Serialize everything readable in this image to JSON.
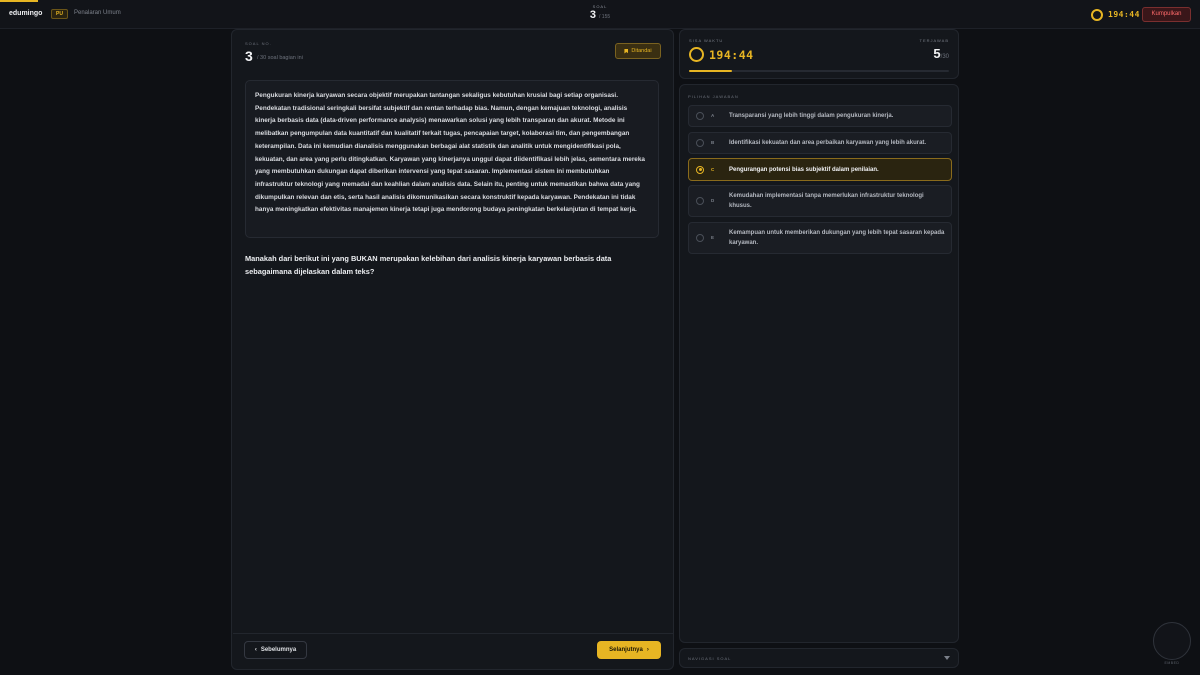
{
  "topbar": {
    "brand": "edumingo",
    "badge": "PU",
    "subject": "Penalaran Umum",
    "soal_label": "SOAL",
    "soal_current": "3",
    "soal_total": "/ 155",
    "timer": "194:44",
    "submit_label": "Kumpulkan"
  },
  "question_panel": {
    "soal_label": "SOAL NO.",
    "number": "3",
    "section_info": "/ 30 soal bagian ini",
    "mark_label": "Ditandai",
    "passage": "Pengukuran kinerja karyawan secara objektif merupakan tantangan sekaligus kebutuhan krusial bagi setiap organisasi. Pendekatan tradisional seringkali bersifat subjektif dan rentan terhadap bias. Namun, dengan kemajuan teknologi, analisis kinerja berbasis data (data-driven performance analysis) menawarkan solusi yang lebih transparan dan akurat. Metode ini melibatkan pengumpulan data kuantitatif dan kualitatif terkait tugas, pencapaian target, kolaborasi tim, dan pengembangan keterampilan. Data ini kemudian dianalisis menggunakan berbagai alat statistik dan analitik untuk mengidentifikasi pola, kekuatan, dan area yang perlu ditingkatkan. Karyawan yang kinerjanya unggul dapat diidentifikasi lebih jelas, sementara mereka yang membutuhkan dukungan dapat diberikan intervensi yang tepat sasaran. Implementasi sistem ini membutuhkan infrastruktur teknologi yang memadai dan keahlian dalam analisis data. Selain itu, penting untuk memastikan bahwa data yang dikumpulkan relevan dan etis, serta hasil analisis dikomunikasikan secara konstruktif kepada karyawan. Pendekatan ini tidak hanya meningkatkan efektivitas manajemen kinerja tetapi juga mendorong budaya peningkatan berkelanjutan di tempat kerja.",
    "question": "Manakah dari berikut ini yang BUKAN merupakan kelebihan dari analisis kinerja karyawan berbasis data sebagaimana dijelaskan dalam teks?",
    "prev_label": "Sebelumnya",
    "next_label": "Selanjutnya"
  },
  "status": {
    "time_label": "SISA WAKTU",
    "time_value": "194:44",
    "answered_label": "TERJAWAB",
    "answered_value": "5",
    "answered_total": "/30",
    "progress_fraction": 0.167
  },
  "options": {
    "label": "PILIHAN JAWABAN",
    "selected": "C",
    "items": [
      {
        "letter": "A",
        "text": "Transparansi yang lebih tinggi dalam pengukuran kinerja."
      },
      {
        "letter": "B",
        "text": "Identifikasi kekuatan dan area perbaikan karyawan yang lebih akurat."
      },
      {
        "letter": "C",
        "text": "Pengurangan potensi bias subjektif dalam penilaian."
      },
      {
        "letter": "D",
        "text": "Kemudahan implementasi tanpa memerlukan infrastruktur teknologi khusus."
      },
      {
        "letter": "E",
        "text": "Kemampuan untuk memberikan dukungan yang lebih tepat sasaran kepada karyawan."
      }
    ]
  },
  "navigation": {
    "label": "NAVIGASI SOAL"
  },
  "floating": {
    "label": "EMBED"
  },
  "colors": {
    "accent": "#e7b523",
    "danger": "#ff6b6b",
    "background": "#0e1014"
  }
}
